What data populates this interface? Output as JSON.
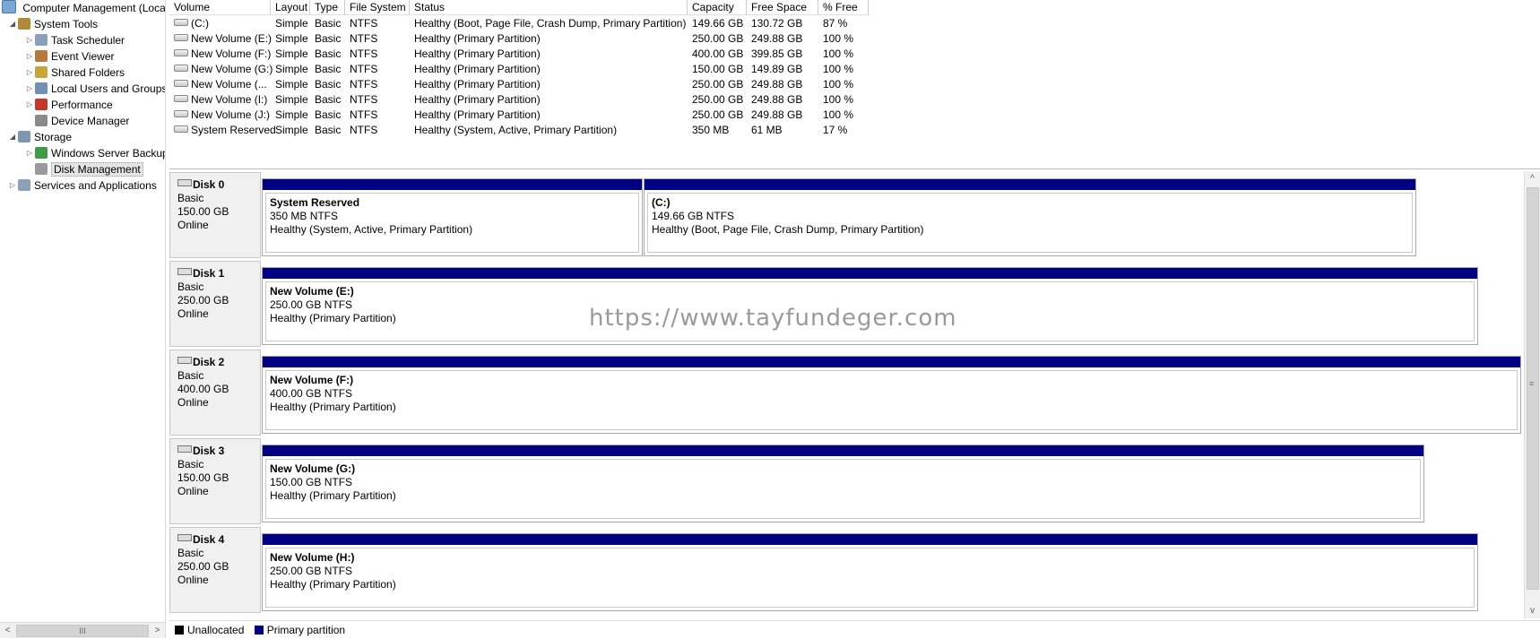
{
  "tree": {
    "root": "Computer Management (Local",
    "items": [
      {
        "label": "System Tools",
        "expander": "◢",
        "icon": "tools-icon"
      },
      {
        "label": "Task Scheduler",
        "expander": "▷",
        "icon": "clock-icon"
      },
      {
        "label": "Event Viewer",
        "expander": "▷",
        "icon": "event-viewer-icon"
      },
      {
        "label": "Shared Folders",
        "expander": "▷",
        "icon": "shared-folder-icon"
      },
      {
        "label": "Local Users and Groups",
        "expander": "▷",
        "icon": "users-icon"
      },
      {
        "label": "Performance",
        "expander": "▷",
        "icon": "performance-icon"
      },
      {
        "label": "Device Manager",
        "expander": "",
        "icon": "device-manager-icon"
      },
      {
        "label": "Storage",
        "expander": "◢",
        "icon": "storage-icon"
      },
      {
        "label": "Windows Server Backup",
        "expander": "▷",
        "icon": "backup-icon"
      },
      {
        "label": "Disk Management",
        "expander": "",
        "icon": "disk-icon"
      },
      {
        "label": "Services and Applications",
        "expander": "▷",
        "icon": "services-icon"
      }
    ],
    "scroll_left": "<",
    "scroll_right": ">",
    "scroll_grip": "III"
  },
  "volume_list": {
    "columns": [
      "Volume",
      "Layout",
      "Type",
      "File System",
      "Status",
      "Capacity",
      "Free Space",
      "% Free"
    ],
    "rows": [
      [
        "(C:)",
        "Simple",
        "Basic",
        "NTFS",
        "Healthy (Boot, Page File, Crash Dump, Primary Partition)",
        "149.66 GB",
        "130.72 GB",
        "87 %"
      ],
      [
        "New Volume (E:)",
        "Simple",
        "Basic",
        "NTFS",
        "Healthy (Primary Partition)",
        "250.00 GB",
        "249.88 GB",
        "100 %"
      ],
      [
        "New Volume (F:)",
        "Simple",
        "Basic",
        "NTFS",
        "Healthy (Primary Partition)",
        "400.00 GB",
        "399.85 GB",
        "100 %"
      ],
      [
        "New Volume (G:)",
        "Simple",
        "Basic",
        "NTFS",
        "Healthy (Primary Partition)",
        "150.00 GB",
        "149.89 GB",
        "100 %"
      ],
      [
        "New Volume (...",
        "Simple",
        "Basic",
        "NTFS",
        "Healthy (Primary Partition)",
        "250.00 GB",
        "249.88 GB",
        "100 %"
      ],
      [
        "New Volume (I:)",
        "Simple",
        "Basic",
        "NTFS",
        "Healthy (Primary Partition)",
        "250.00 GB",
        "249.88 GB",
        "100 %"
      ],
      [
        "New Volume (J:)",
        "Simple",
        "Basic",
        "NTFS",
        "Healthy (Primary Partition)",
        "250.00 GB",
        "249.88 GB",
        "100 %"
      ],
      [
        "System Reserved",
        "Simple",
        "Basic",
        "NTFS",
        "Healthy (System, Active, Primary Partition)",
        "350 MB",
        "61 MB",
        "17 %"
      ]
    ]
  },
  "disks": [
    {
      "name": "Disk 0",
      "type": "Basic",
      "size": "150.00 GB",
      "state": "Online",
      "partitions": [
        {
          "name": "System Reserved",
          "size": "350 MB NTFS",
          "status": "Healthy (System, Active, Primary Partition)"
        },
        {
          "name": "(C:)",
          "size": "149.66 GB NTFS",
          "status": "Healthy (Boot, Page File, Crash Dump, Primary Partition)"
        }
      ]
    },
    {
      "name": "Disk 1",
      "type": "Basic",
      "size": "250.00 GB",
      "state": "Online",
      "partitions": [
        {
          "name": "New Volume  (E:)",
          "size": "250.00 GB NTFS",
          "status": "Healthy (Primary Partition)"
        }
      ]
    },
    {
      "name": "Disk 2",
      "type": "Basic",
      "size": "400.00 GB",
      "state": "Online",
      "partitions": [
        {
          "name": "New Volume  (F:)",
          "size": "400.00 GB NTFS",
          "status": "Healthy (Primary Partition)"
        }
      ]
    },
    {
      "name": "Disk 3",
      "type": "Basic",
      "size": "150.00 GB",
      "state": "Online",
      "partitions": [
        {
          "name": "New Volume  (G:)",
          "size": "150.00 GB NTFS",
          "status": "Healthy (Primary Partition)"
        }
      ]
    },
    {
      "name": "Disk 4",
      "type": "Basic",
      "size": "250.00 GB",
      "state": "Online",
      "partitions": [
        {
          "name": "New Volume  (H:)",
          "size": "250.00 GB NTFS",
          "status": "Healthy (Primary Partition)"
        }
      ]
    }
  ],
  "watermark": "https://www.tayfundeger.com",
  "legend": {
    "unallocated": "Unallocated",
    "primary": "Primary partition",
    "unallocated_color": "#000000",
    "primary_color": "#000080"
  },
  "scrollbar": {
    "up": "^",
    "down": "v",
    "grip": "≡"
  }
}
